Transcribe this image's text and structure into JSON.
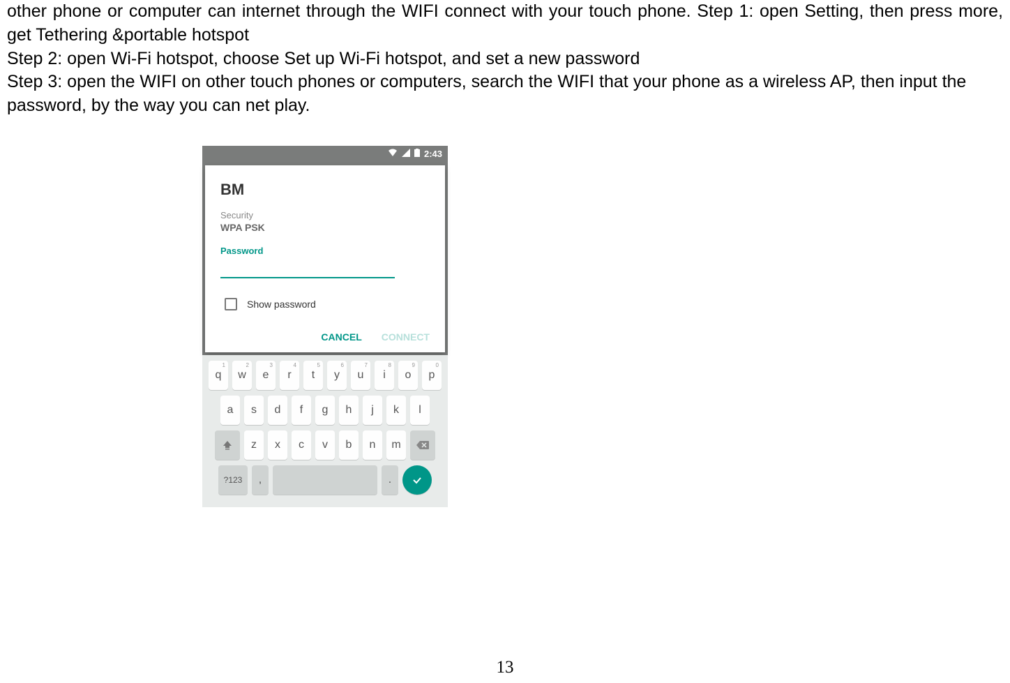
{
  "doc": {
    "line1": "other phone or computer can internet through the WIFI connect with your touch phone. Step 1: open Setting, then press more, get Tethering &portable hotspot",
    "line2": "Step 2: open Wi-Fi hotspot, choose Set up Wi-Fi hotspot, and set a new password",
    "line3": "Step 3: open the WIFI on other touch phones or computers, search the WIFI that your phone as a wireless AP, then input the password, by the way you can net play."
  },
  "statusbar": {
    "time": "2:43"
  },
  "dialog": {
    "title": "BM",
    "security_label": "Security",
    "security_value": "WPA PSK",
    "password_label": "Password",
    "password_value": "",
    "show_password": "Show password",
    "cancel": "CANCEL",
    "connect": "CONNECT"
  },
  "keyboard": {
    "row1": [
      "q",
      "w",
      "e",
      "r",
      "t",
      "y",
      "u",
      "i",
      "o",
      "p"
    ],
    "row1_hints": [
      "1",
      "2",
      "3",
      "4",
      "5",
      "6",
      "7",
      "8",
      "9",
      "0"
    ],
    "row2": [
      "a",
      "s",
      "d",
      "f",
      "g",
      "h",
      "j",
      "k",
      "l"
    ],
    "row3": [
      "z",
      "x",
      "c",
      "v",
      "b",
      "n",
      "m"
    ],
    "sym": "?123",
    "comma": ",",
    "period": "."
  },
  "page_number": "13"
}
